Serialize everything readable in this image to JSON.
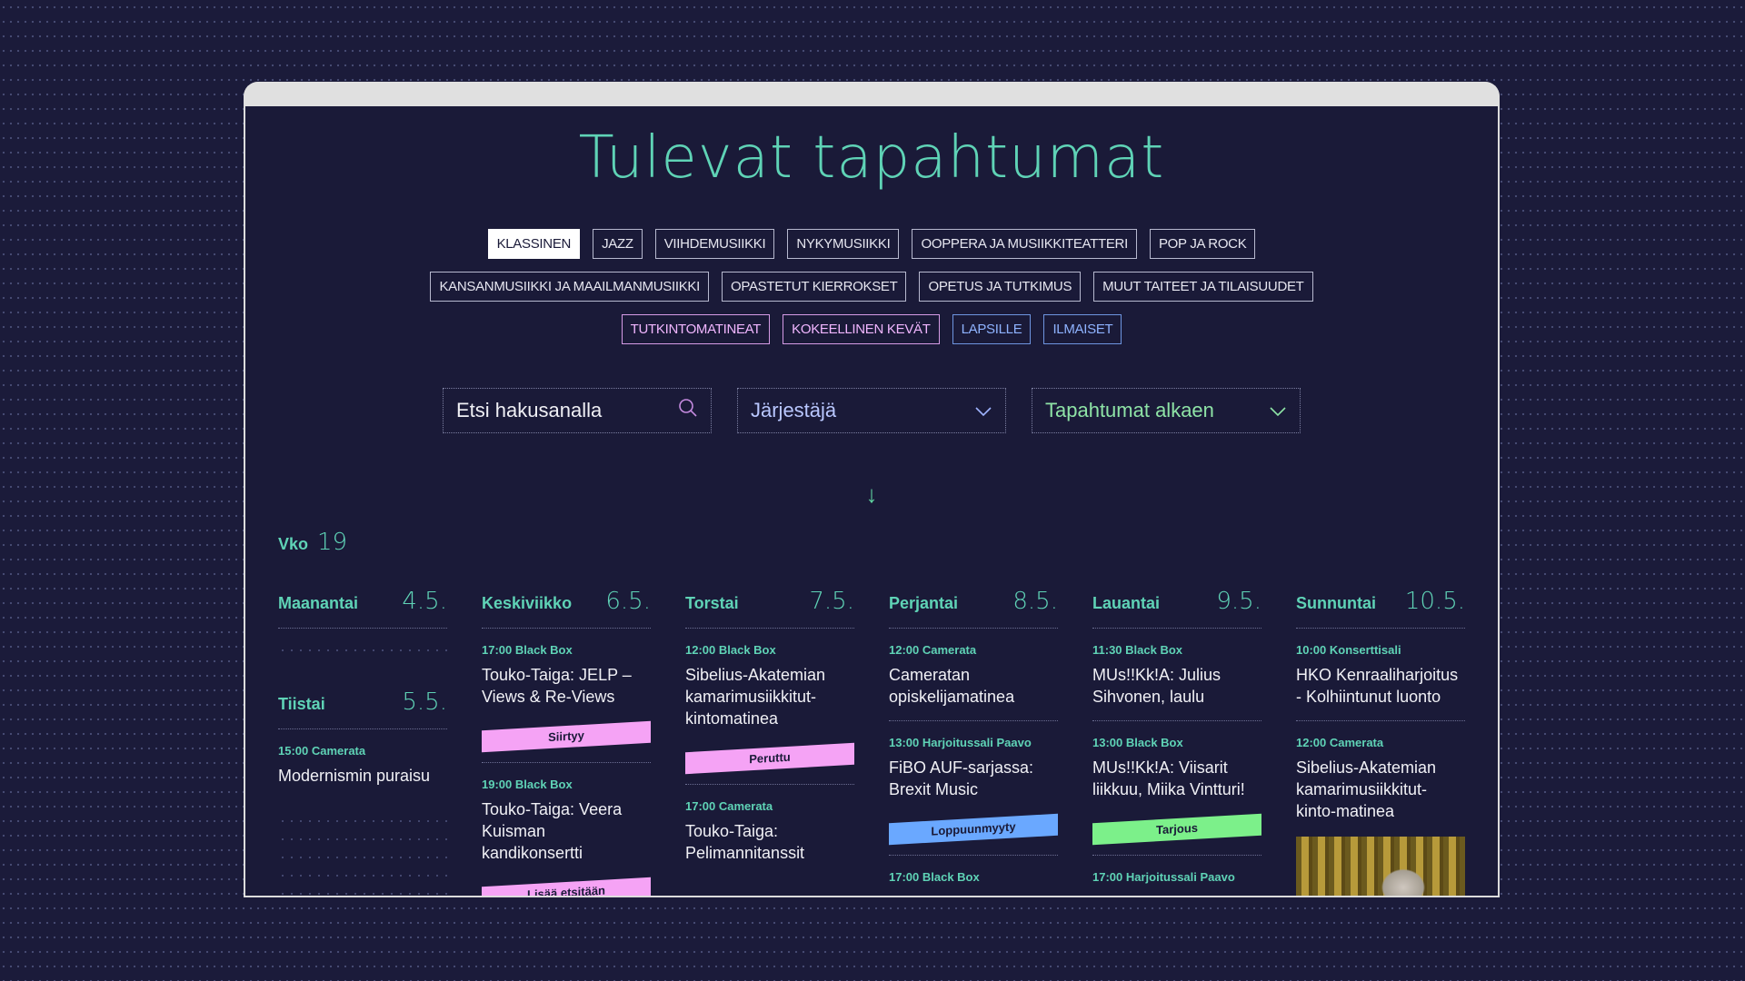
{
  "page": {
    "title": "Tulevat tapahtumat"
  },
  "filters": {
    "row1": [
      {
        "label": "KLASSINEN",
        "style": "active"
      },
      {
        "label": "JAZZ",
        "style": "default"
      },
      {
        "label": "VIIHDEMUSIIKKI",
        "style": "default"
      },
      {
        "label": "NYKYMUSIIKKI",
        "style": "default"
      },
      {
        "label": "OOPPERA JA MUSIIKKITEATTERI",
        "style": "default"
      },
      {
        "label": "POP JA ROCK",
        "style": "default"
      }
    ],
    "row2": [
      {
        "label": "KANSANMUSIIKKI JA MAAILMANMUSIIKKI",
        "style": "default"
      },
      {
        "label": "OPASTETUT KIERROKSET",
        "style": "default"
      },
      {
        "label": "OPETUS JA TUTKIMUS",
        "style": "default"
      },
      {
        "label": "MUUT TAITEET JA TILAISUUDET",
        "style": "default"
      }
    ],
    "row3": [
      {
        "label": "TUTKINTOMATINEAT",
        "style": "pink"
      },
      {
        "label": "KOKEELLINEN KEVÄT",
        "style": "pink"
      },
      {
        "label": "LAPSILLE",
        "style": "blue"
      },
      {
        "label": "ILMAISET",
        "style": "blue"
      }
    ]
  },
  "controls": {
    "search_placeholder": "Etsi hakusanalla",
    "search_icon": "search-icon",
    "organizer_label": "Järjestäjä",
    "date_label": "Tapahtumat alkaen",
    "chevron_icon": "chevron-down-icon",
    "scroll_arrow": "↓"
  },
  "week": {
    "label": "Vko",
    "number": "19"
  },
  "colors": {
    "accent": "#5fd3b6",
    "background": "#1a1a38",
    "badge_pink": "#f5a3f5",
    "badge_blue": "#6aa8ff",
    "badge_green": "#7cf08a"
  },
  "days": [
    {
      "name": "Maanantai",
      "date": "4.5.",
      "events": [],
      "second": {
        "name": "Tiistai",
        "date": "5.5.",
        "events": [
          {
            "meta": "15:00 Camerata",
            "title": "Modernismin puraisu"
          }
        ]
      }
    },
    {
      "name": "Keskiviikko",
      "date": "6.5.",
      "events": [
        {
          "meta": "17:00 Black Box",
          "title": "Touko-Taiga: JELP – Views & Re-Views",
          "badge": "Siirtyy",
          "badge_color": "pink"
        },
        {
          "meta": "19:00 Black Box",
          "title": "Touko-Taiga: Veera Kuisman kandikonsertti",
          "badge": "Lisää etsitään",
          "badge_color": "pink"
        }
      ]
    },
    {
      "name": "Torstai",
      "date": "7.5.",
      "events": [
        {
          "meta": "12:00 Black Box",
          "title": "Sibelius-Akatemian kamarimusiikkitut-kintomatinea",
          "badge": "Peruttu",
          "badge_color": "pink"
        },
        {
          "meta": "17:00 Camerata",
          "title": "Touko-Taiga: Pelimannitanssit"
        }
      ]
    },
    {
      "name": "Perjantai",
      "date": "8.5.",
      "events": [
        {
          "meta": "12:00 Camerata",
          "title": "Cameratan opiskelijamatinea"
        },
        {
          "meta": "13:00 Harjoitussali Paavo",
          "title": "FiBO AUF-sarjassa: Brexit Music",
          "badge": "Loppuunmyyty",
          "badge_color": "blue"
        },
        {
          "meta": "17:00 Black Box",
          "title": ""
        }
      ]
    },
    {
      "name": "Lauantai",
      "date": "9.5.",
      "events": [
        {
          "meta": "11:30 Black Box",
          "title": "MUs!!Kk!A: Julius Sihvonen, laulu"
        },
        {
          "meta": "13:00 Black Box",
          "title": "MUs!!Kk!A: Viisarit liikkuu, Miika Vintturi!",
          "badge": "Tarjous",
          "badge_color": "green"
        },
        {
          "meta": "17:00 Harjoitussali Paavo",
          "title": ""
        }
      ]
    },
    {
      "name": "Sunnuntai",
      "date": "10.5.",
      "events": [
        {
          "meta": "10:00 Konserttisali",
          "title": "HKO Kenraaliharjoitus - Kolhiintunut luonto"
        },
        {
          "meta": "12:00 Camerata",
          "title": "Sibelius-Akatemian kamarimusiikkitut-kinto-matinea",
          "image": "event-photo"
        }
      ]
    }
  ]
}
